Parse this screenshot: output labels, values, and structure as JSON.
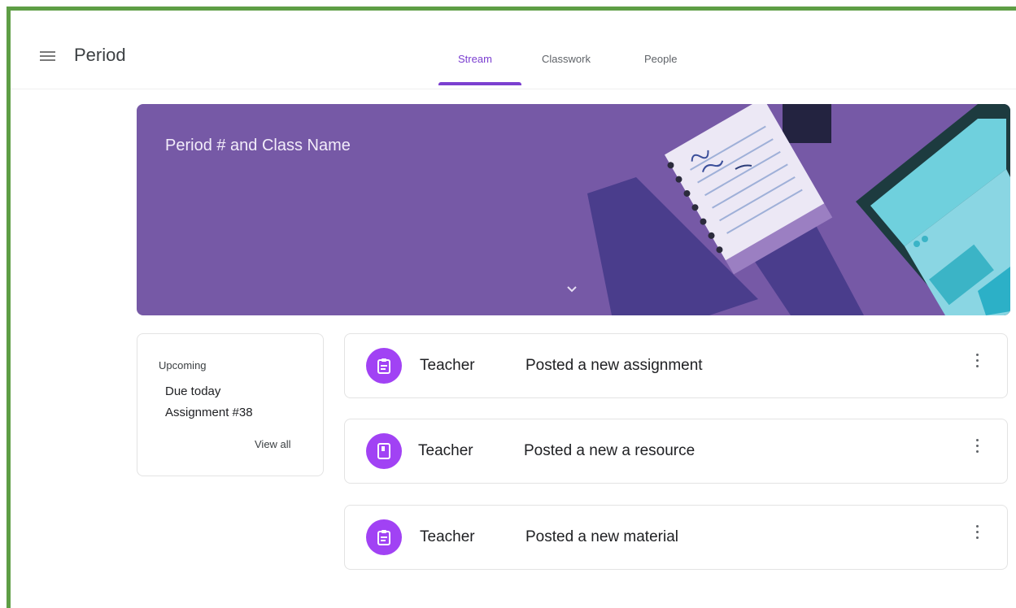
{
  "header": {
    "title": "Period",
    "tabs": [
      {
        "label": "Stream",
        "active": true
      },
      {
        "label": "Classwork",
        "active": false
      },
      {
        "label": "People",
        "active": false
      }
    ]
  },
  "banner": {
    "title": "Period # and Class Name",
    "color": "#7659a6"
  },
  "upcoming": {
    "label": "Upcoming",
    "due": "Due today",
    "assignment": "Assignment #38",
    "view_all": "View all"
  },
  "posts": [
    {
      "author": "Teacher",
      "text": "Posted a new assignment",
      "icon": "assignment-icon"
    },
    {
      "author": "Teacher",
      "text": "Posted a new a resource",
      "icon": "book-icon"
    },
    {
      "author": "Teacher",
      "text": "Posted a new material",
      "icon": "material-icon"
    }
  ],
  "colors": {
    "accent": "#7b3fd0",
    "icon_bg": "#a142f4",
    "frame": "#5e9e45"
  }
}
